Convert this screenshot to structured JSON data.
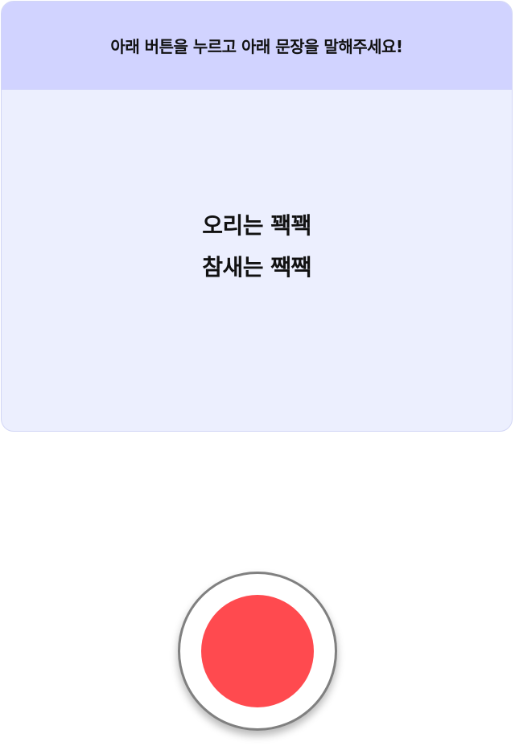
{
  "instruction": "아래 버튼을 누르고 아래 문장을 말해주세요!",
  "sentence": {
    "line1": "오리는 꽥꽥",
    "line2": "참새는 짹짹"
  },
  "record_button": {
    "icon": "record-dot-icon",
    "color": "#ff4a4f"
  },
  "colors": {
    "header_bg": "#d1d3ff",
    "card_bg": "#eceffe"
  }
}
